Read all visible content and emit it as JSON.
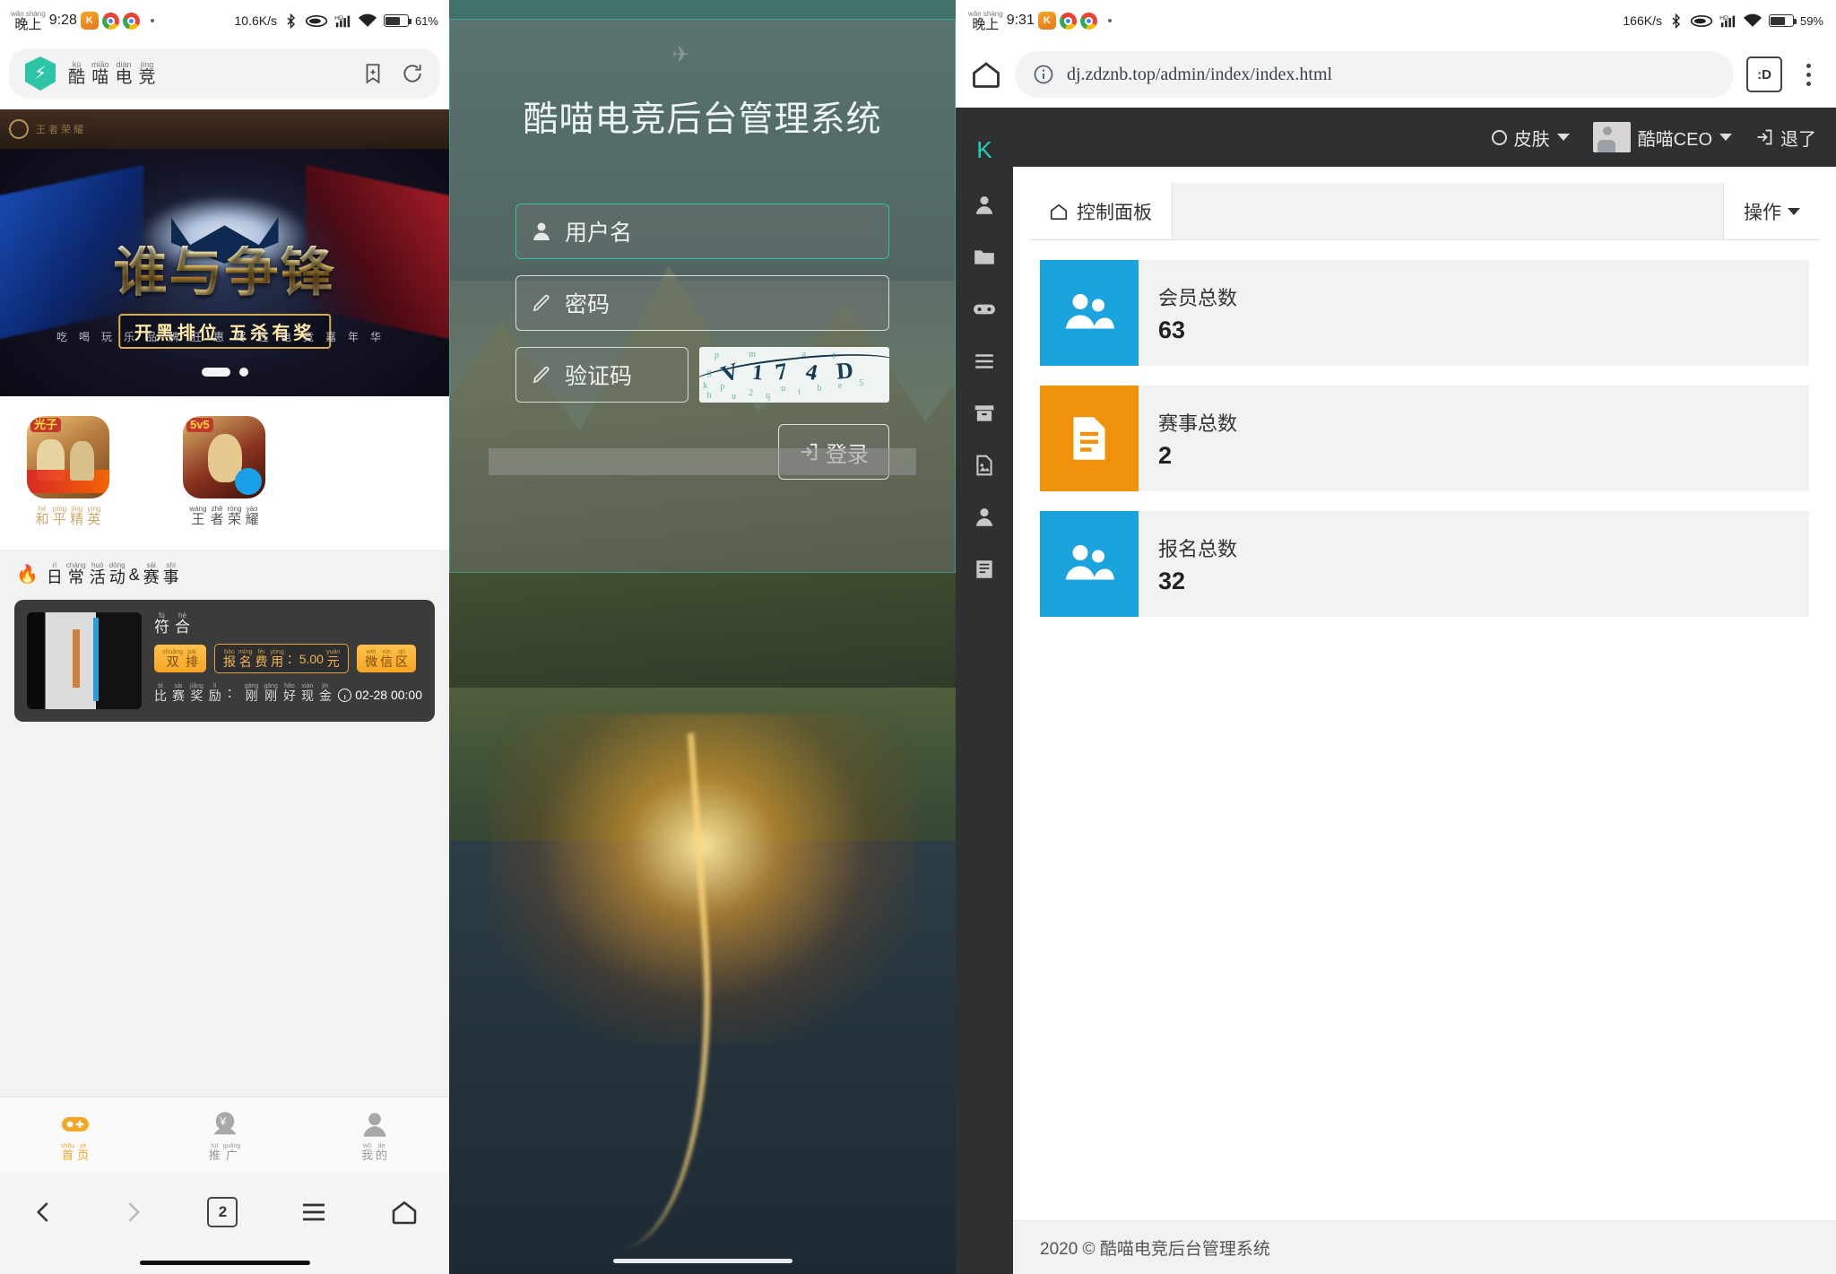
{
  "panel1": {
    "status": {
      "time_py": "wǎn shàng",
      "time_hz": "晚上",
      "clock": "9:28",
      "net_speed": "10.6K/s",
      "battery": "61%",
      "icons": [
        "app-k-icon",
        "chrome-icon",
        "chrome-icon",
        "dot-icon",
        "bluetooth-icon",
        "ellipse-icon",
        "hd-signal-icon",
        "wifi-icon",
        "battery-icon"
      ]
    },
    "appbar": {
      "title_chars": [
        {
          "py": "kù",
          "hz": "酷"
        },
        {
          "py": "miāo",
          "hz": "喵"
        },
        {
          "py": "diàn",
          "hz": "电"
        },
        {
          "py": "jìng",
          "hz": "竞"
        }
      ],
      "bookmark_icon": "bookmark-add-icon",
      "refresh_icon": "refresh-icon"
    },
    "banner": {
      "brand": "王者荣耀",
      "title": "谁与争锋",
      "subtitle": "开黑排位 五杀有奖",
      "slogan": "吃喝玩乐品牌狂惠尽在电竞嘉年华",
      "dots_total": 2,
      "dot_active": 1
    },
    "games": [
      {
        "name_chars": [
          {
            "py": "hé",
            "hz": "和"
          },
          {
            "py": "píng",
            "hz": "平"
          },
          {
            "py": "jīng",
            "hz": "精"
          },
          {
            "py": "yīng",
            "hz": "英"
          }
        ],
        "badge": "光子"
      },
      {
        "name_chars": [
          {
            "py": "wáng",
            "hz": "王"
          },
          {
            "py": "zhě",
            "hz": "者"
          },
          {
            "py": "róng",
            "hz": "荣"
          },
          {
            "py": "yào",
            "hz": "耀"
          }
        ],
        "badge": "5v5"
      }
    ],
    "section": {
      "fire_icon": "fire-icon",
      "title_chars": [
        {
          "py": "rì",
          "hz": "日"
        },
        {
          "py": "cháng",
          "hz": "常"
        },
        {
          "py": "huó",
          "hz": "活"
        },
        {
          "py": "dòng",
          "hz": "动"
        }
      ],
      "amp": "&",
      "title_chars2": [
        {
          "py": "sài",
          "hz": "赛"
        },
        {
          "py": "shì",
          "hz": "事"
        }
      ]
    },
    "activity": {
      "title_chars": [
        {
          "py": "fú",
          "hz": "符"
        },
        {
          "py": "hé",
          "hz": "合"
        }
      ],
      "tag_mode": [
        {
          "py": "shuāng",
          "hz": "双"
        },
        {
          "py": "pái",
          "hz": "排"
        }
      ],
      "tag_fee_label": [
        {
          "py": "bào",
          "hz": "报"
        },
        {
          "py": "míng",
          "hz": "名"
        },
        {
          "py": "fèi",
          "hz": "费"
        },
        {
          "py": "yòng",
          "hz": "用"
        }
      ],
      "tag_fee_value": "：5.00",
      "tag_fee_unit": [
        {
          "py": "yuán",
          "hz": "元"
        }
      ],
      "tag_zone": [
        {
          "py": "wēi",
          "hz": "微"
        },
        {
          "py": "xìn",
          "hz": "信"
        },
        {
          "py": "qū",
          "hz": "区"
        }
      ],
      "reward_label": [
        {
          "py": "bǐ",
          "hz": "比"
        },
        {
          "py": "sài",
          "hz": "赛"
        },
        {
          "py": "jiǎng",
          "hz": "奖"
        },
        {
          "py": "lì",
          "hz": "励"
        }
      ],
      "reward_colon": "：",
      "reward_value": [
        {
          "py": "gāng",
          "hz": "刚"
        },
        {
          "py": "gāng",
          "hz": "刚"
        },
        {
          "py": "hǎo",
          "hz": "好"
        },
        {
          "py": "xiàn",
          "hz": "现"
        },
        {
          "py": "jīn",
          "hz": "金"
        }
      ],
      "time": "02-28 00:00",
      "clock_icon": "clock-icon"
    },
    "tabbar": [
      {
        "icon": "gamepad-icon",
        "chars": [
          {
            "py": "shǒu",
            "hz": "首"
          },
          {
            "py": "yè",
            "hz": "页"
          }
        ],
        "active": true
      },
      {
        "icon": "promote-icon",
        "chars": [
          {
            "py": "tuī",
            "hz": "推"
          },
          {
            "py": "guǎng",
            "hz": "广"
          }
        ],
        "active": false
      },
      {
        "icon": "person-icon",
        "chars": [
          {
            "py": "wǒ",
            "hz": "我"
          },
          {
            "py": "de",
            "hz": "的"
          }
        ],
        "active": false
      }
    ],
    "navbar": {
      "back_icon": "chevron-left-icon",
      "forward_icon": "chevron-right-icon",
      "tab_count": "2",
      "menu_icon": "hamburger-icon",
      "home_icon": "home-outline-icon"
    }
  },
  "panel2": {
    "title": "酷喵电竞后台管理系统",
    "fields": [
      {
        "icon": "user-icon",
        "placeholder": "用户名",
        "focused": true
      },
      {
        "icon": "pencil-icon",
        "placeholder": "密码",
        "focused": false
      },
      {
        "icon": "pencil-icon",
        "placeholder": "验证码",
        "focused": false
      }
    ],
    "captcha": {
      "chars": "V174D",
      "noise": [
        "p",
        "m",
        "g",
        "a",
        "f",
        "k",
        "p",
        "h",
        "u",
        "2",
        "q",
        "u",
        "t",
        "b",
        "e",
        "5",
        "d",
        "j",
        "u",
        "m",
        "m",
        "o"
      ]
    },
    "login_button": {
      "label": "登录",
      "icon": "login-arrow-icon"
    }
  },
  "panel3": {
    "status": {
      "time_py": "wǎn shàng",
      "time_hz": "晚上",
      "clock": "9:31",
      "net_speed": "166K/s",
      "battery": "59%"
    },
    "browser": {
      "home_icon": "home-icon",
      "info_icon": "info-circle-icon",
      "url": "dj.zdznb.top/admin/index/index.html",
      "tab_count": ":D",
      "menu_icon": "kebab-menu-icon"
    },
    "brand": "K",
    "sidebar_icons": [
      "user-icon",
      "folder-icon",
      "gamepad-icon",
      "list-icon",
      "archive-icon",
      "image-icon",
      "member-icon",
      "document-icon"
    ],
    "topbar": {
      "skin_label": "皮肤",
      "skin_icon": "circle-icon",
      "user_label": "酷喵CEO",
      "avatar_icon": "avatar-icon",
      "logout_label": "退了",
      "logout_icon": "exit-icon"
    },
    "tab": {
      "label": "控制面板",
      "icon": "house-icon"
    },
    "operation": {
      "label": "操作",
      "icon": "caret-down-icon"
    },
    "stats": [
      {
        "label": "会员总数",
        "value": "63",
        "color": "#1aa3dd",
        "icon": "group-icon"
      },
      {
        "label": "赛事总数",
        "value": "2",
        "color": "#f0930b",
        "icon": "document-lines-icon"
      },
      {
        "label": "报名总数",
        "value": "32",
        "color": "#1aa3dd",
        "icon": "group-icon"
      }
    ],
    "footer": "2020 © 酷喵电竞后台管理系统"
  }
}
